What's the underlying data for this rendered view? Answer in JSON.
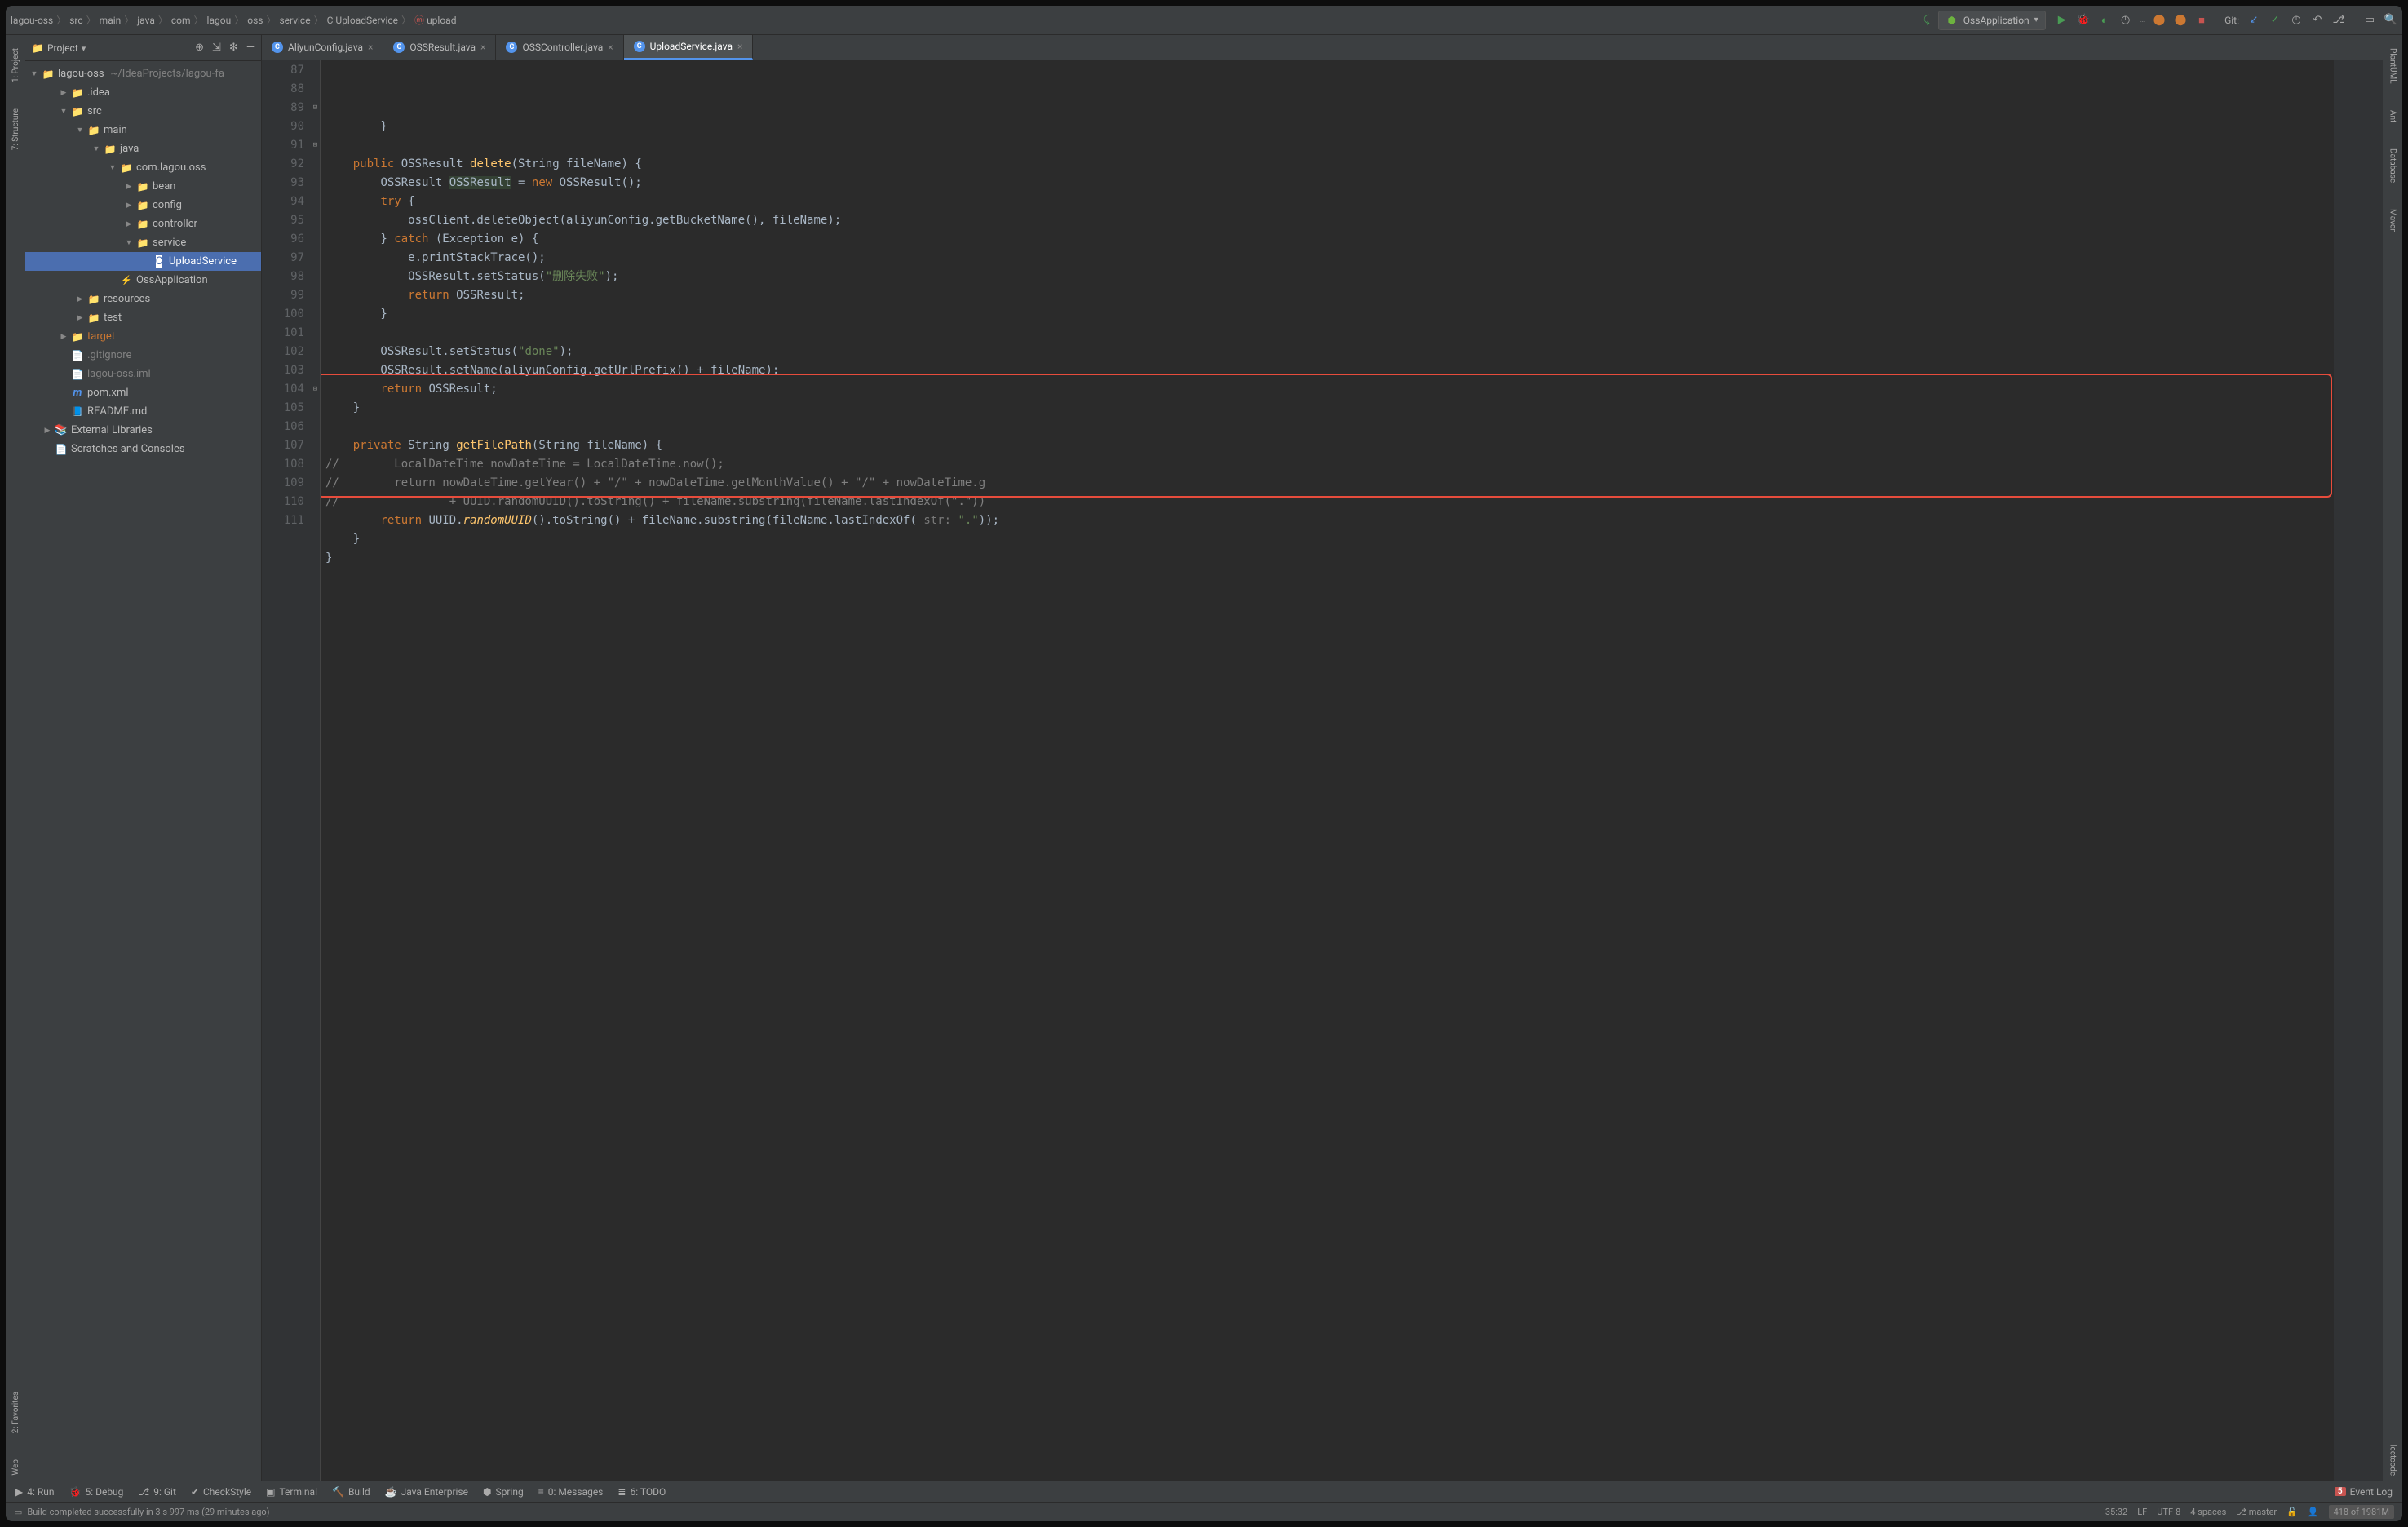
{
  "breadcrumb": [
    "lagou-oss",
    "src",
    "main",
    "java",
    "com",
    "lagou",
    "oss",
    "service",
    "UploadService",
    "upload"
  ],
  "run_config": "OssApplication",
  "git_label": "Git:",
  "project": {
    "title": "Project",
    "root": {
      "name": "lagou-oss",
      "hint": "~/IdeaProjects/lagou-fa"
    },
    "tree": [
      {
        "indent": 1,
        "arrow": "▶",
        "icon": "folder",
        "label": ".idea"
      },
      {
        "indent": 1,
        "arrow": "▼",
        "icon": "folder",
        "label": "src"
      },
      {
        "indent": 2,
        "arrow": "▼",
        "icon": "folder",
        "label": "main"
      },
      {
        "indent": 3,
        "arrow": "▼",
        "icon": "folder",
        "label": "java"
      },
      {
        "indent": 4,
        "arrow": "▼",
        "icon": "folder",
        "label": "com.lagou.oss"
      },
      {
        "indent": 5,
        "arrow": "▶",
        "icon": "folder",
        "label": "bean"
      },
      {
        "indent": 5,
        "arrow": "▶",
        "icon": "folder",
        "label": "config"
      },
      {
        "indent": 5,
        "arrow": "▶",
        "icon": "folder",
        "label": "controller"
      },
      {
        "indent": 5,
        "arrow": "▼",
        "icon": "folder",
        "label": "service"
      },
      {
        "indent": 6,
        "arrow": "",
        "icon": "class",
        "label": "UploadService",
        "selected": true
      },
      {
        "indent": 4,
        "arrow": "",
        "icon": "sboot",
        "label": "OssApplication"
      },
      {
        "indent": 2,
        "arrow": "▶",
        "icon": "folder",
        "label": "resources"
      },
      {
        "indent": 2,
        "arrow": "▶",
        "icon": "folder",
        "label": "test"
      },
      {
        "indent": 1,
        "arrow": "▶",
        "icon": "folder",
        "label": "target",
        "target": true
      },
      {
        "indent": 1,
        "arrow": "",
        "icon": "file",
        "label": ".gitignore",
        "dim": true
      },
      {
        "indent": 1,
        "arrow": "",
        "icon": "file",
        "label": "lagou-oss.iml",
        "dim": true
      },
      {
        "indent": 1,
        "arrow": "",
        "icon": "m",
        "label": "pom.xml"
      },
      {
        "indent": 1,
        "arrow": "",
        "icon": "md",
        "label": "README.md"
      },
      {
        "indent": 0,
        "arrow": "▶",
        "icon": "lib",
        "label": "External Libraries"
      },
      {
        "indent": 0,
        "arrow": "",
        "icon": "file",
        "label": "Scratches and Consoles"
      }
    ]
  },
  "tabs": [
    {
      "label": "AliyunConfig.java",
      "active": false
    },
    {
      "label": "OSSResult.java",
      "active": false
    },
    {
      "label": "OSSController.java",
      "active": false
    },
    {
      "label": "UploadService.java",
      "active": true
    }
  ],
  "gutter_start": 87,
  "gutter_end": 111,
  "code_lines": [
    {
      "n": 87,
      "html": "        }"
    },
    {
      "n": 88,
      "html": ""
    },
    {
      "n": 89,
      "html": "    <span class='kw'>public</span> <span class='type'>OSSResult</span> <span class='fn'>delete</span>(<span class='type'>String</span> fileName) {"
    },
    {
      "n": 90,
      "html": "        <span class='type'>OSSResult</span> <span class='bold-hl'>OSSResult</span> = <span class='kw'>new</span> OSSResult();"
    },
    {
      "n": 91,
      "html": "        <span class='kw'>try</span> {"
    },
    {
      "n": 92,
      "html": "            ossClient.deleteObject(aliyunConfig.getBucketName(), fileName);"
    },
    {
      "n": 93,
      "html": "        } <span class='kw'>catch</span> (Exception e) {"
    },
    {
      "n": 94,
      "html": "            e.printStackTrace();"
    },
    {
      "n": 95,
      "html": "            OSSResult.setStatus(<span class='str'>\"删除失败\"</span>);"
    },
    {
      "n": 96,
      "html": "            <span class='kw'>return</span> OSSResult;"
    },
    {
      "n": 97,
      "html": "        }"
    },
    {
      "n": 98,
      "html": ""
    },
    {
      "n": 99,
      "html": "        OSSResult.setStatus(<span class='str'>\"done\"</span>);"
    },
    {
      "n": 100,
      "html": "        OSSResult.setName(aliyunConfig.getUrlPrefix() + fileName);"
    },
    {
      "n": 101,
      "html": "        <span class='kw'>return</span> OSSResult;"
    },
    {
      "n": 102,
      "html": "    }"
    },
    {
      "n": 103,
      "html": ""
    },
    {
      "n": 104,
      "html": "    <span class='kw'>private</span> <span class='type'>String</span> <span class='fn'>getFilePath</span>(<span class='type'>String</span> fileName) {"
    },
    {
      "n": 105,
      "html": "<span class='comm'>//        LocalDateTime nowDateTime = LocalDateTime.now();</span>"
    },
    {
      "n": 106,
      "html": "<span class='comm'>//        return nowDateTime.getYear() + \"/\" + nowDateTime.getMonthValue() + \"/\" + nowDateTime.g</span>"
    },
    {
      "n": 107,
      "html": "<span class='comm'>//                + UUID.randomUUID().toString() + fileName.substring(fileName.lastIndexOf(\".\"))</span>"
    },
    {
      "n": 108,
      "html": "        <span class='kw'>return</span> UUID.<span class='mname'>randomUUID</span>().toString() + fileName.substring(fileName.lastIndexOf( <span class='hint'>str:</span> <span class='str'>\".\"</span>));"
    },
    {
      "n": 109,
      "html": "    }"
    },
    {
      "n": 110,
      "html": "}"
    },
    {
      "n": 111,
      "html": ""
    }
  ],
  "left_tools": [
    "1: Project",
    "7: Structure",
    "2: Favorites",
    "Web"
  ],
  "right_tools": [
    "PlantUML",
    "Ant",
    "Database",
    "Maven",
    "leetcode"
  ],
  "bottom_tools": {
    "run": "4: Run",
    "debug": "5: Debug",
    "git": "9: Git",
    "check": "CheckStyle",
    "term": "Terminal",
    "build": "Build",
    "je": "Java Enterprise",
    "spring": "Spring",
    "msg": "0: Messages",
    "todo": "6: TODO",
    "event_log": "Event Log",
    "event_badge": "5"
  },
  "status": {
    "msg": "Build completed successfully in 3 s 997 ms (29 minutes ago)",
    "pos": "35:32",
    "line_sep": "LF",
    "enc": "UTF-8",
    "indent": "4 spaces",
    "branch": "master",
    "mem": "418 of 1981M"
  }
}
